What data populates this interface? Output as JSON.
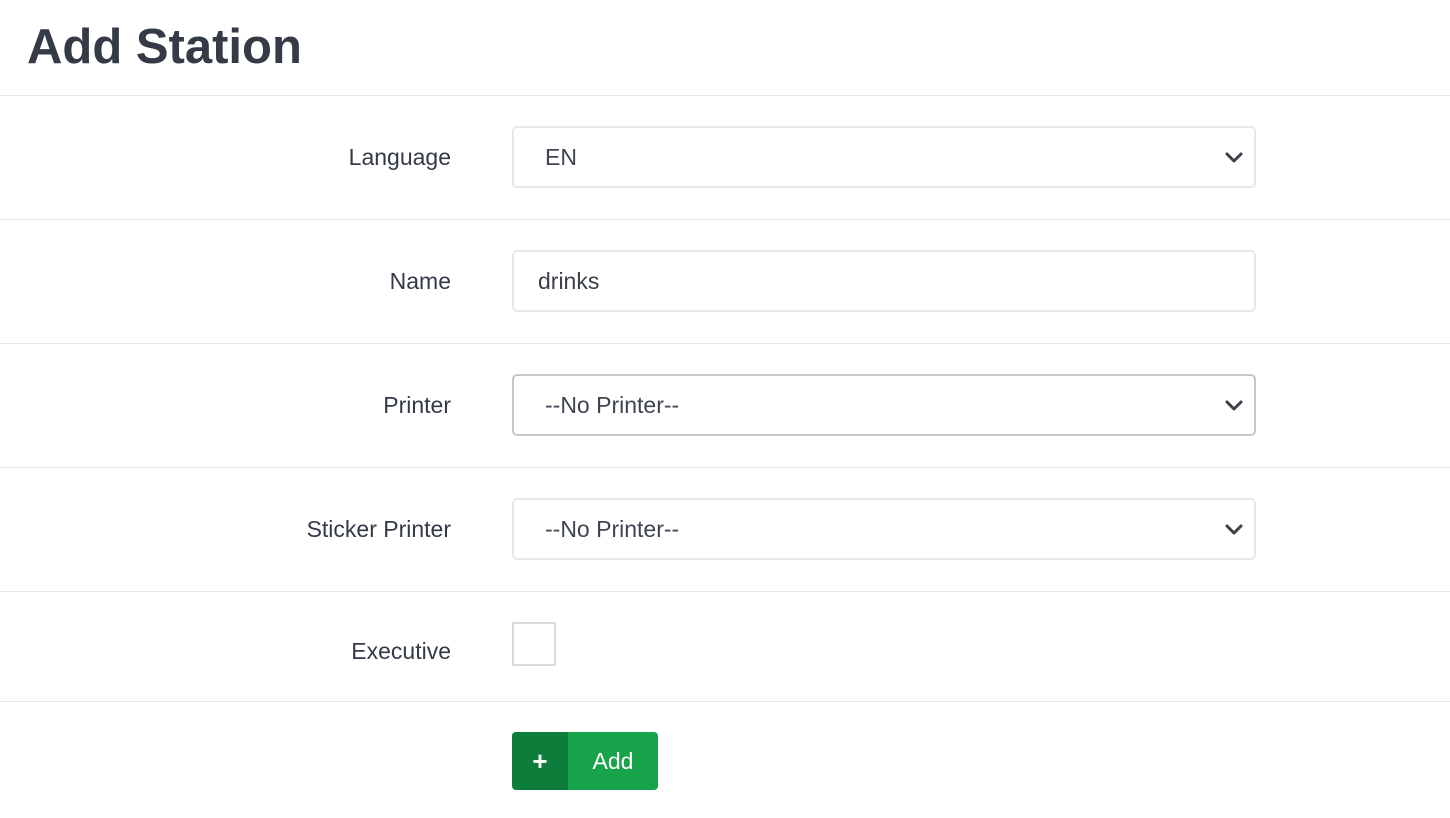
{
  "page": {
    "title": "Add Station"
  },
  "form": {
    "language": {
      "label": "Language",
      "selected": "EN"
    },
    "name": {
      "label": "Name",
      "value": "drinks"
    },
    "printer": {
      "label": "Printer",
      "selected": "--No Printer--"
    },
    "sticker_printer": {
      "label": "Sticker Printer",
      "selected": "--No Printer--"
    },
    "executive": {
      "label": "Executive",
      "checked": false
    },
    "submit": {
      "icon": "+",
      "label": "Add"
    }
  },
  "colors": {
    "button_icon_bg": "#0d7d3c",
    "button_bg": "#16a34a",
    "text": "#343a46",
    "border": "#e6e8eb"
  }
}
